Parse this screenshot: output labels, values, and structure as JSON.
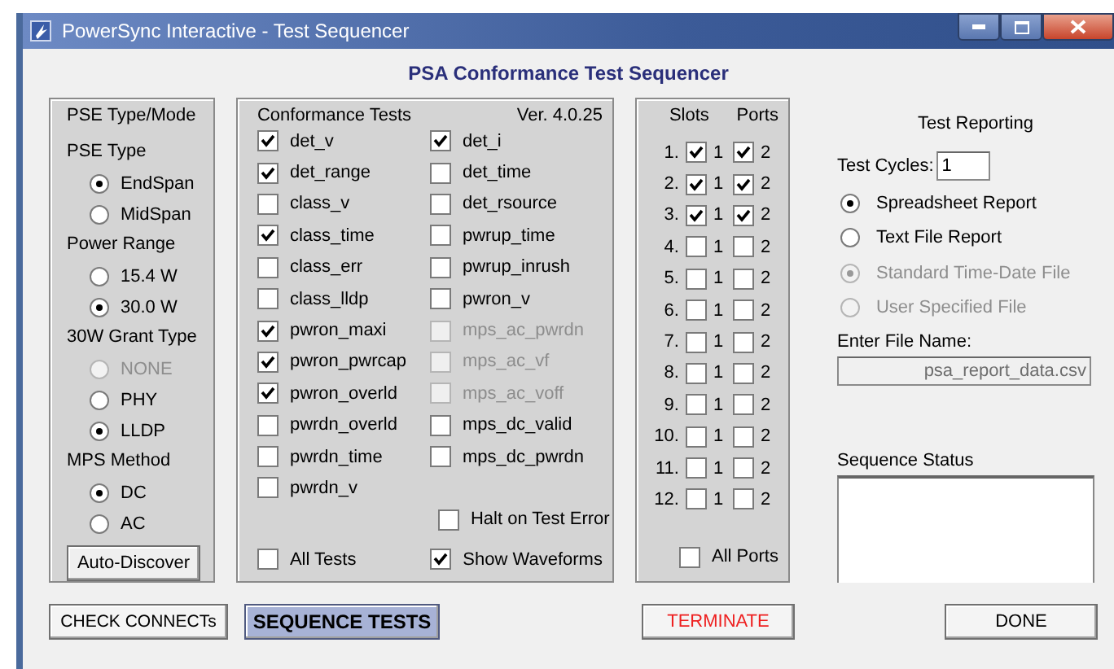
{
  "window": {
    "title": "PowerSync Interactive - Test Sequencer"
  },
  "heading": "PSA Conformance Test Sequencer",
  "pse_panel": {
    "title": "PSE Type/Mode",
    "groups": [
      {
        "label": "PSE Type",
        "options": [
          {
            "label": "EndSpan",
            "selected": true,
            "disabled": false
          },
          {
            "label": "MidSpan",
            "selected": false,
            "disabled": false
          }
        ]
      },
      {
        "label": "Power Range",
        "options": [
          {
            "label": "15.4 W",
            "selected": false,
            "disabled": false
          },
          {
            "label": "30.0 W",
            "selected": true,
            "disabled": false
          }
        ]
      },
      {
        "label": "30W Grant Type",
        "options": [
          {
            "label": "NONE",
            "selected": false,
            "disabled": true
          },
          {
            "label": "PHY",
            "selected": false,
            "disabled": false
          },
          {
            "label": "LLDP",
            "selected": true,
            "disabled": false
          }
        ]
      },
      {
        "label": "MPS Method",
        "options": [
          {
            "label": "DC",
            "selected": true,
            "disabled": false
          },
          {
            "label": "AC",
            "selected": false,
            "disabled": false
          }
        ]
      }
    ],
    "button": "Auto-Discover"
  },
  "tests_panel": {
    "title": "Conformance Tests",
    "version": "Ver. 4.0.25",
    "columns": [
      [
        {
          "label": "det_v",
          "checked": true,
          "disabled": false
        },
        {
          "label": "det_range",
          "checked": true,
          "disabled": false
        },
        {
          "label": "class_v",
          "checked": false,
          "disabled": false
        },
        {
          "label": "class_time",
          "checked": true,
          "disabled": false
        },
        {
          "label": "class_err",
          "checked": false,
          "disabled": false
        },
        {
          "label": "class_lldp",
          "checked": false,
          "disabled": false
        },
        {
          "label": "pwron_maxi",
          "checked": true,
          "disabled": false
        },
        {
          "label": "pwron_pwrcap",
          "checked": true,
          "disabled": false
        },
        {
          "label": "pwron_overld",
          "checked": true,
          "disabled": false
        },
        {
          "label": "pwrdn_overld",
          "checked": false,
          "disabled": false
        },
        {
          "label": "pwrdn_time",
          "checked": false,
          "disabled": false
        },
        {
          "label": "pwrdn_v",
          "checked": false,
          "disabled": false
        }
      ],
      [
        {
          "label": "det_i",
          "checked": true,
          "disabled": false
        },
        {
          "label": "det_time",
          "checked": false,
          "disabled": false
        },
        {
          "label": "det_rsource",
          "checked": false,
          "disabled": false
        },
        {
          "label": "pwrup_time",
          "checked": false,
          "disabled": false
        },
        {
          "label": "pwrup_inrush",
          "checked": false,
          "disabled": false
        },
        {
          "label": "pwron_v",
          "checked": false,
          "disabled": false
        },
        {
          "label": "mps_ac_pwrdn",
          "checked": false,
          "disabled": true
        },
        {
          "label": "mps_ac_vf",
          "checked": false,
          "disabled": true
        },
        {
          "label": "mps_ac_voff",
          "checked": false,
          "disabled": true
        },
        {
          "label": "mps_dc_valid",
          "checked": false,
          "disabled": false
        },
        {
          "label": "mps_dc_pwrdn",
          "checked": false,
          "disabled": false
        }
      ]
    ],
    "halt": {
      "label": "Halt on Test Error",
      "checked": false
    },
    "all_tests": {
      "label": "All Tests",
      "checked": false
    },
    "show_waveforms": {
      "label": "Show Waveforms",
      "checked": true
    }
  },
  "slots_panel": {
    "slots_heading": "Slots",
    "ports_heading": "Ports",
    "rows": [
      {
        "label": "1.",
        "ports": [
          {
            "label": "1",
            "checked": true
          },
          {
            "label": "2",
            "checked": true
          }
        ]
      },
      {
        "label": "2.",
        "ports": [
          {
            "label": "1",
            "checked": true
          },
          {
            "label": "2",
            "checked": true
          }
        ]
      },
      {
        "label": "3.",
        "ports": [
          {
            "label": "1",
            "checked": true
          },
          {
            "label": "2",
            "checked": true
          }
        ]
      },
      {
        "label": "4.",
        "ports": [
          {
            "label": "1",
            "checked": false
          },
          {
            "label": "2",
            "checked": false
          }
        ]
      },
      {
        "label": "5.",
        "ports": [
          {
            "label": "1",
            "checked": false
          },
          {
            "label": "2",
            "checked": false
          }
        ]
      },
      {
        "label": "6.",
        "ports": [
          {
            "label": "1",
            "checked": false
          },
          {
            "label": "2",
            "checked": false
          }
        ]
      },
      {
        "label": "7.",
        "ports": [
          {
            "label": "1",
            "checked": false
          },
          {
            "label": "2",
            "checked": false
          }
        ]
      },
      {
        "label": "8.",
        "ports": [
          {
            "label": "1",
            "checked": false
          },
          {
            "label": "2",
            "checked": false
          }
        ]
      },
      {
        "label": "9.",
        "ports": [
          {
            "label": "1",
            "checked": false
          },
          {
            "label": "2",
            "checked": false
          }
        ]
      },
      {
        "label": "10.",
        "ports": [
          {
            "label": "1",
            "checked": false
          },
          {
            "label": "2",
            "checked": false
          }
        ]
      },
      {
        "label": "11.",
        "ports": [
          {
            "label": "1",
            "checked": false
          },
          {
            "label": "2",
            "checked": false
          }
        ]
      },
      {
        "label": "12.",
        "ports": [
          {
            "label": "1",
            "checked": false
          },
          {
            "label": "2",
            "checked": false
          }
        ]
      }
    ],
    "all_ports": {
      "label": "All Ports",
      "checked": false
    }
  },
  "reporting": {
    "title": "Test Reporting",
    "test_cycles_label": "Test Cycles:",
    "test_cycles": "1",
    "report_options": [
      {
        "label": "Spreadsheet Report",
        "selected": true,
        "disabled": false
      },
      {
        "label": "Text File Report",
        "selected": false,
        "disabled": false
      }
    ],
    "file_options": [
      {
        "label": "Standard Time-Date File",
        "selected": true,
        "disabled": true
      },
      {
        "label": "User Specified File",
        "selected": false,
        "disabled": true
      }
    ],
    "file_name_label": "Enter File Name:",
    "file_name": "psa_report_data.csv",
    "status_label": "Sequence Status"
  },
  "buttons": [
    {
      "label": "CHECK CONNECTs",
      "kind": "normal"
    },
    {
      "label": "SEQUENCE TESTS",
      "kind": "primary"
    },
    {
      "label": "TERMINATE",
      "kind": "danger"
    },
    {
      "label": "DONE",
      "kind": "normal"
    }
  ]
}
